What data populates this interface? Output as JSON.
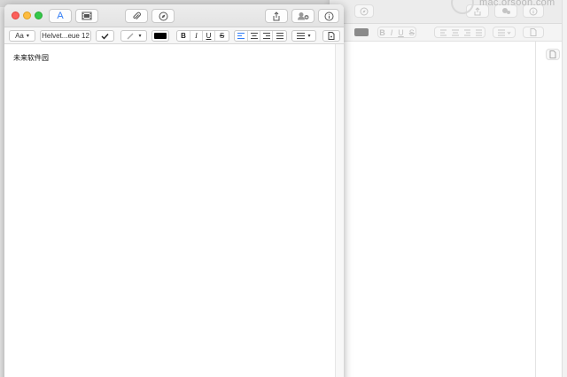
{
  "watermark": "mac.orsoon.com",
  "format_bar": {
    "style_label": "Aa",
    "font_label": "Helvet...eue 12"
  },
  "document": {
    "text": "未来软件园"
  },
  "colors": {
    "close": "#fc605c",
    "minimize": "#fdbc40",
    "zoom": "#34c84a",
    "accent": "#2f7bf5",
    "text_color_swatch": "#000000"
  },
  "icons": {
    "format": "A",
    "bold": "B",
    "italic": "I",
    "underline": "U",
    "strike": "S"
  }
}
